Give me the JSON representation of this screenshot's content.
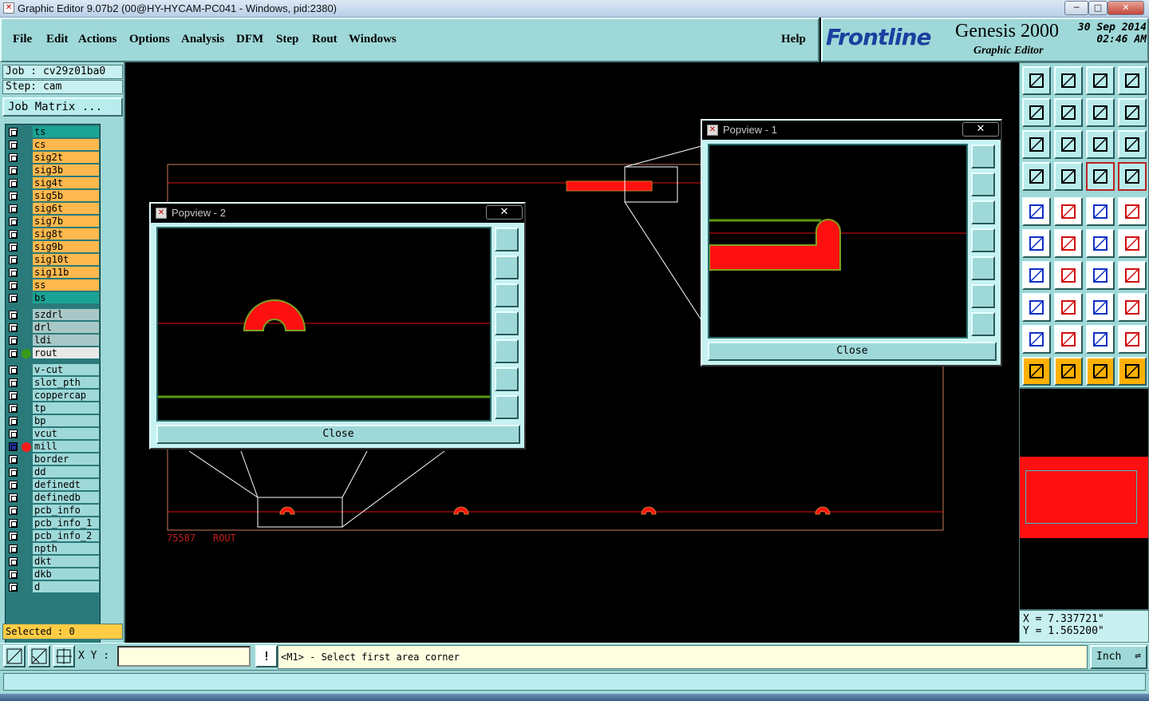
{
  "window": {
    "title": "Graphic Editor 9.07b2 (00@HY-HYCAM-PC041 - Windows, pid:2380)",
    "controls": {
      "minimize": "─",
      "maximize": "□",
      "close": "✕"
    }
  },
  "menu": {
    "items": [
      "File",
      "Edit",
      "Actions",
      "Options",
      "Analysis",
      "DFM",
      "Step",
      "Rout",
      "Windows"
    ],
    "help": "Help"
  },
  "brand": {
    "logo": "Frontline",
    "product": "Genesis 2000",
    "module": "Graphic Editor",
    "date": "30 Sep 2014",
    "time": "02:46 AM"
  },
  "job": {
    "job_line": "Job : cv29z01ba0",
    "step_line": "Step: cam",
    "matrix_button": "Job Matrix ..."
  },
  "layers": [
    {
      "name": "ts",
      "color": "#1aa394",
      "dot": ""
    },
    {
      "name": "cs",
      "color": "#ffb84d",
      "dot": ""
    },
    {
      "name": "sig2t",
      "color": "#ffb84d",
      "dot": ""
    },
    {
      "name": "sig3b",
      "color": "#ffb84d",
      "dot": ""
    },
    {
      "name": "sig4t",
      "color": "#ffb84d",
      "dot": ""
    },
    {
      "name": "sig5b",
      "color": "#ffb84d",
      "dot": ""
    },
    {
      "name": "sig6t",
      "color": "#ffb84d",
      "dot": ""
    },
    {
      "name": "sig7b",
      "color": "#ffb84d",
      "dot": ""
    },
    {
      "name": "sig8t",
      "color": "#ffb84d",
      "dot": ""
    },
    {
      "name": "sig9b",
      "color": "#ffb84d",
      "dot": ""
    },
    {
      "name": "sig10t",
      "color": "#ffb84d",
      "dot": ""
    },
    {
      "name": "sig11b",
      "color": "#ffb84d",
      "dot": ""
    },
    {
      "name": "ss",
      "color": "#ffb84d",
      "dot": ""
    },
    {
      "name": "bs",
      "color": "#1aa394",
      "dot": ""
    },
    {
      "name": "szdrl",
      "color": "#a8c8c8",
      "dot": "",
      "gap": true
    },
    {
      "name": "drl",
      "color": "#a8c8c8",
      "dot": ""
    },
    {
      "name": "ldi",
      "color": "#a8c8c8",
      "dot": ""
    },
    {
      "name": "rout",
      "color": "#e8e8e8",
      "dot": "#3a9a1a"
    },
    {
      "name": "v-cut",
      "color": "#9fd8d8",
      "dot": "",
      "gap": true
    },
    {
      "name": "slot_pth",
      "color": "#9fd8d8",
      "dot": ""
    },
    {
      "name": "coppercap",
      "color": "#9fd8d8",
      "dot": ""
    },
    {
      "name": "tp",
      "color": "#9fd8d8",
      "dot": ""
    },
    {
      "name": "bp",
      "color": "#9fd8d8",
      "dot": ""
    },
    {
      "name": "vcut",
      "color": "#9fd8d8",
      "dot": ""
    },
    {
      "name": "mill",
      "color": "#9fd8d8",
      "dot": "#ff1a1a",
      "active": true
    },
    {
      "name": "border",
      "color": "#9fd8d8",
      "dot": ""
    },
    {
      "name": "dd",
      "color": "#9fd8d8",
      "dot": ""
    },
    {
      "name": "definedt",
      "color": "#9fd8d8",
      "dot": ""
    },
    {
      "name": "definedb",
      "color": "#9fd8d8",
      "dot": ""
    },
    {
      "name": "pcb_info",
      "color": "#9fd8d8",
      "dot": ""
    },
    {
      "name": "pcb_info_1",
      "color": "#9fd8d8",
      "dot": ""
    },
    {
      "name": "pcb_info_2",
      "color": "#9fd8d8",
      "dot": ""
    },
    {
      "name": "npth",
      "color": "#9fd8d8",
      "dot": ""
    },
    {
      "name": "dkt",
      "color": "#9fd8d8",
      "dot": ""
    },
    {
      "name": "dkb",
      "color": "#9fd8d8",
      "dot": ""
    },
    {
      "name": "d",
      "color": "#9fd8d8",
      "dot": ""
    }
  ],
  "selected": "Selected : 0",
  "canvas": {
    "label_number": "75587",
    "label_layer": "ROUT"
  },
  "popview1": {
    "title": "Popview - 1",
    "close_label": "Close"
  },
  "popview2": {
    "title": "Popview - 2",
    "close_label": "Close"
  },
  "coords": {
    "x": "X = 7.337721\"",
    "y": "Y = 1.565200\""
  },
  "bottom": {
    "xy_label": "X Y :",
    "xy_value": "",
    "warning": "!",
    "prompt": "<M1> - Select first area corner",
    "units": "Inch"
  }
}
